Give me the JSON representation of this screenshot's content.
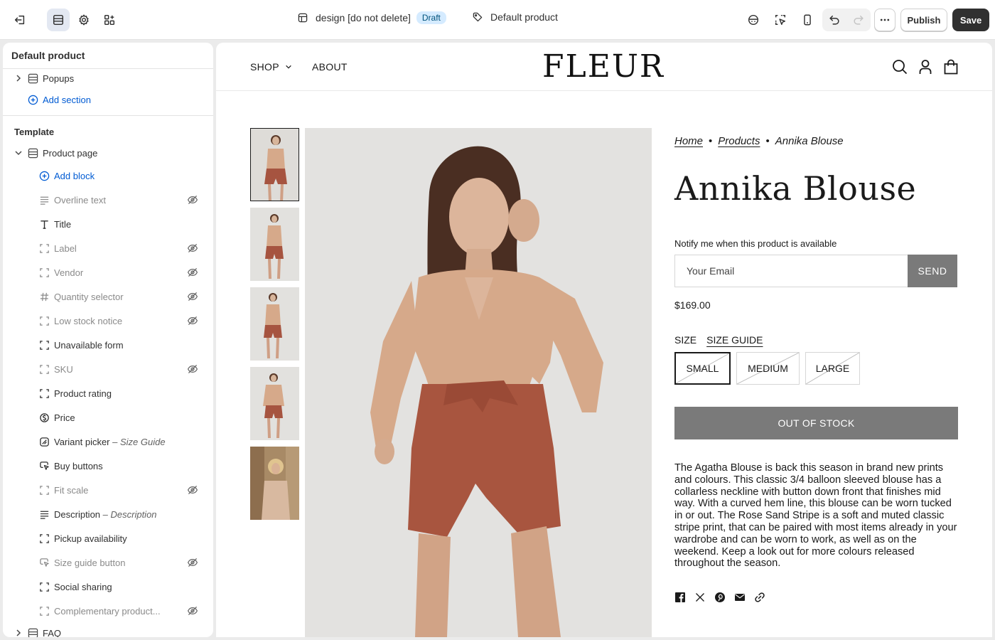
{
  "topbar": {
    "store_name": "design [do not delete]",
    "status_badge": "Draft",
    "template_name": "Default product",
    "publish_label": "Publish",
    "save_label": "Save"
  },
  "sidebar": {
    "title": "Default product",
    "popups_label": "Popups",
    "add_section_label": "Add section",
    "template_heading": "Template",
    "product_page_label": "Product page",
    "add_block_label": "Add block",
    "blocks": [
      {
        "label": "Overline text",
        "sub": "",
        "hidden": true
      },
      {
        "label": "Title",
        "sub": "",
        "hidden": false
      },
      {
        "label": "Label",
        "sub": "",
        "hidden": true
      },
      {
        "label": "Vendor",
        "sub": "",
        "hidden": true
      },
      {
        "label": "Quantity selector",
        "sub": "",
        "hidden": true
      },
      {
        "label": "Low stock notice",
        "sub": "",
        "hidden": true
      },
      {
        "label": "Unavailable form",
        "sub": "",
        "hidden": false
      },
      {
        "label": "SKU",
        "sub": "",
        "hidden": true
      },
      {
        "label": "Product rating",
        "sub": "",
        "hidden": false
      },
      {
        "label": "Price",
        "sub": "",
        "hidden": false
      },
      {
        "label": "Variant picker",
        "sub": "– Size Guide",
        "hidden": false
      },
      {
        "label": "Buy buttons",
        "sub": "",
        "hidden": false
      },
      {
        "label": "Fit scale",
        "sub": "",
        "hidden": true
      },
      {
        "label": "Description",
        "sub": "– Description",
        "hidden": false
      },
      {
        "label": "Pickup availability",
        "sub": "",
        "hidden": false
      },
      {
        "label": "Size guide button",
        "sub": "",
        "hidden": true
      },
      {
        "label": "Social sharing",
        "sub": "",
        "hidden": false
      },
      {
        "label": "Complementary product...",
        "sub": "",
        "hidden": true
      }
    ],
    "faq_label": "FAQ"
  },
  "store": {
    "nav_shop": "SHOP",
    "nav_about": "ABOUT",
    "logo": "FLEUR",
    "breadcrumb_home": "Home",
    "breadcrumb_products": "Products",
    "breadcrumb_current": "Annika Blouse",
    "product_title": "Annika Blouse",
    "notify_label": "Notify me when this product is available",
    "email_placeholder": "Your Email",
    "send_label": "SEND",
    "price": "$169.00",
    "size_label": "SIZE",
    "size_guide_label": "SIZE GUIDE",
    "sizes": [
      "SMALL",
      "MEDIUM",
      "LARGE"
    ],
    "selected_size": "SMALL",
    "oos_label": "OUT OF STOCK",
    "description": "The Agatha Blouse is back this season in brand new prints and colours. This classic 3/4 balloon sleeved blouse has a collarless neckline with button down front that finishes mid way. With a curved hem line, this blouse can be worn tucked in or out. The Rose Sand Stripe is a soft and muted classic stripe print, that can be paired with most items already in your wardrobe and can be worn to work, as well as on the weekend. Keep a look out for more colours released throughout the season.",
    "share_icons": [
      "facebook-icon",
      "x-icon",
      "pinterest-icon",
      "email-icon",
      "link-icon"
    ]
  },
  "colors": {
    "accent_blue": "#005bd3",
    "draft_badge_bg": "#d5ebff",
    "save_button": "#303030",
    "disabled_button": "#7a7a7a"
  }
}
